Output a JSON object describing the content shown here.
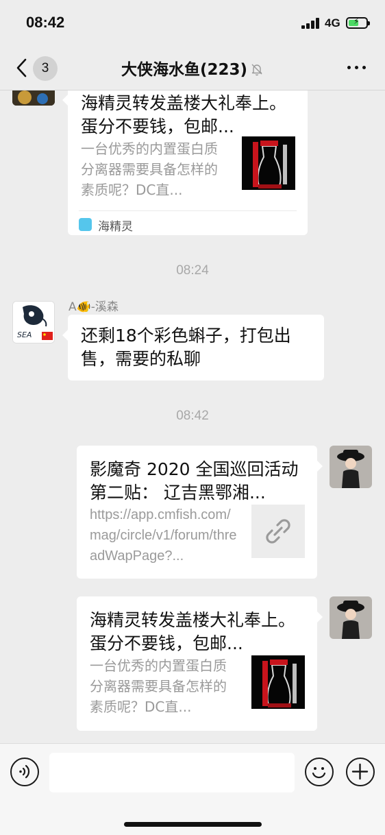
{
  "status_bar": {
    "time": "08:42",
    "network": "4G",
    "battery_charging": true,
    "battery_level_fraction": 0.6
  },
  "nav": {
    "back_icon": "chevron-left-icon",
    "unread_count": "3",
    "title": "大侠海水鱼(223)",
    "mute_icon": "bell-slash-icon",
    "more_icon": "more-icon"
  },
  "messages": [
    {
      "type": "article-card",
      "side": "left",
      "title": "海精灵转发盖楼大礼奉上。蛋分不要钱，包邮...",
      "description": "一台优秀的内置蛋白质分离器需要具备怎样的素质呢？DC直...",
      "source": "海精灵"
    },
    {
      "type": "timestamp",
      "text": "08:24"
    },
    {
      "type": "text",
      "side": "left",
      "sender": "A🐠-溪森",
      "avatar_text": "SEA",
      "text": "还剩18个彩色蝌子，打包出售，需要的私聊"
    },
    {
      "type": "timestamp",
      "text": "08:42"
    },
    {
      "type": "link-card",
      "side": "right",
      "title": "影魔奇 2020 全国巡回活动第二贴： 辽吉黑鄂湘...",
      "description": "https://app.cmfish.com/mag/circle/v1/forum/threadWapPage?...",
      "thumb_icon": "link-icon"
    },
    {
      "type": "article-card",
      "side": "right",
      "title": "海精灵转发盖楼大礼奉上。蛋分不要钱，包邮...",
      "description": "一台优秀的内置蛋白质分离器需要具备怎样的素质呢？DC直..."
    }
  ],
  "input_bar": {
    "voice_icon": "voice-icon",
    "emoji_icon": "emoji-icon",
    "plus_icon": "plus-icon",
    "text_value": ""
  },
  "colors": {
    "background": "#ededed",
    "bubble": "#ffffff",
    "battery": "#4cd964",
    "timestamp": "#a8a8a8"
  }
}
